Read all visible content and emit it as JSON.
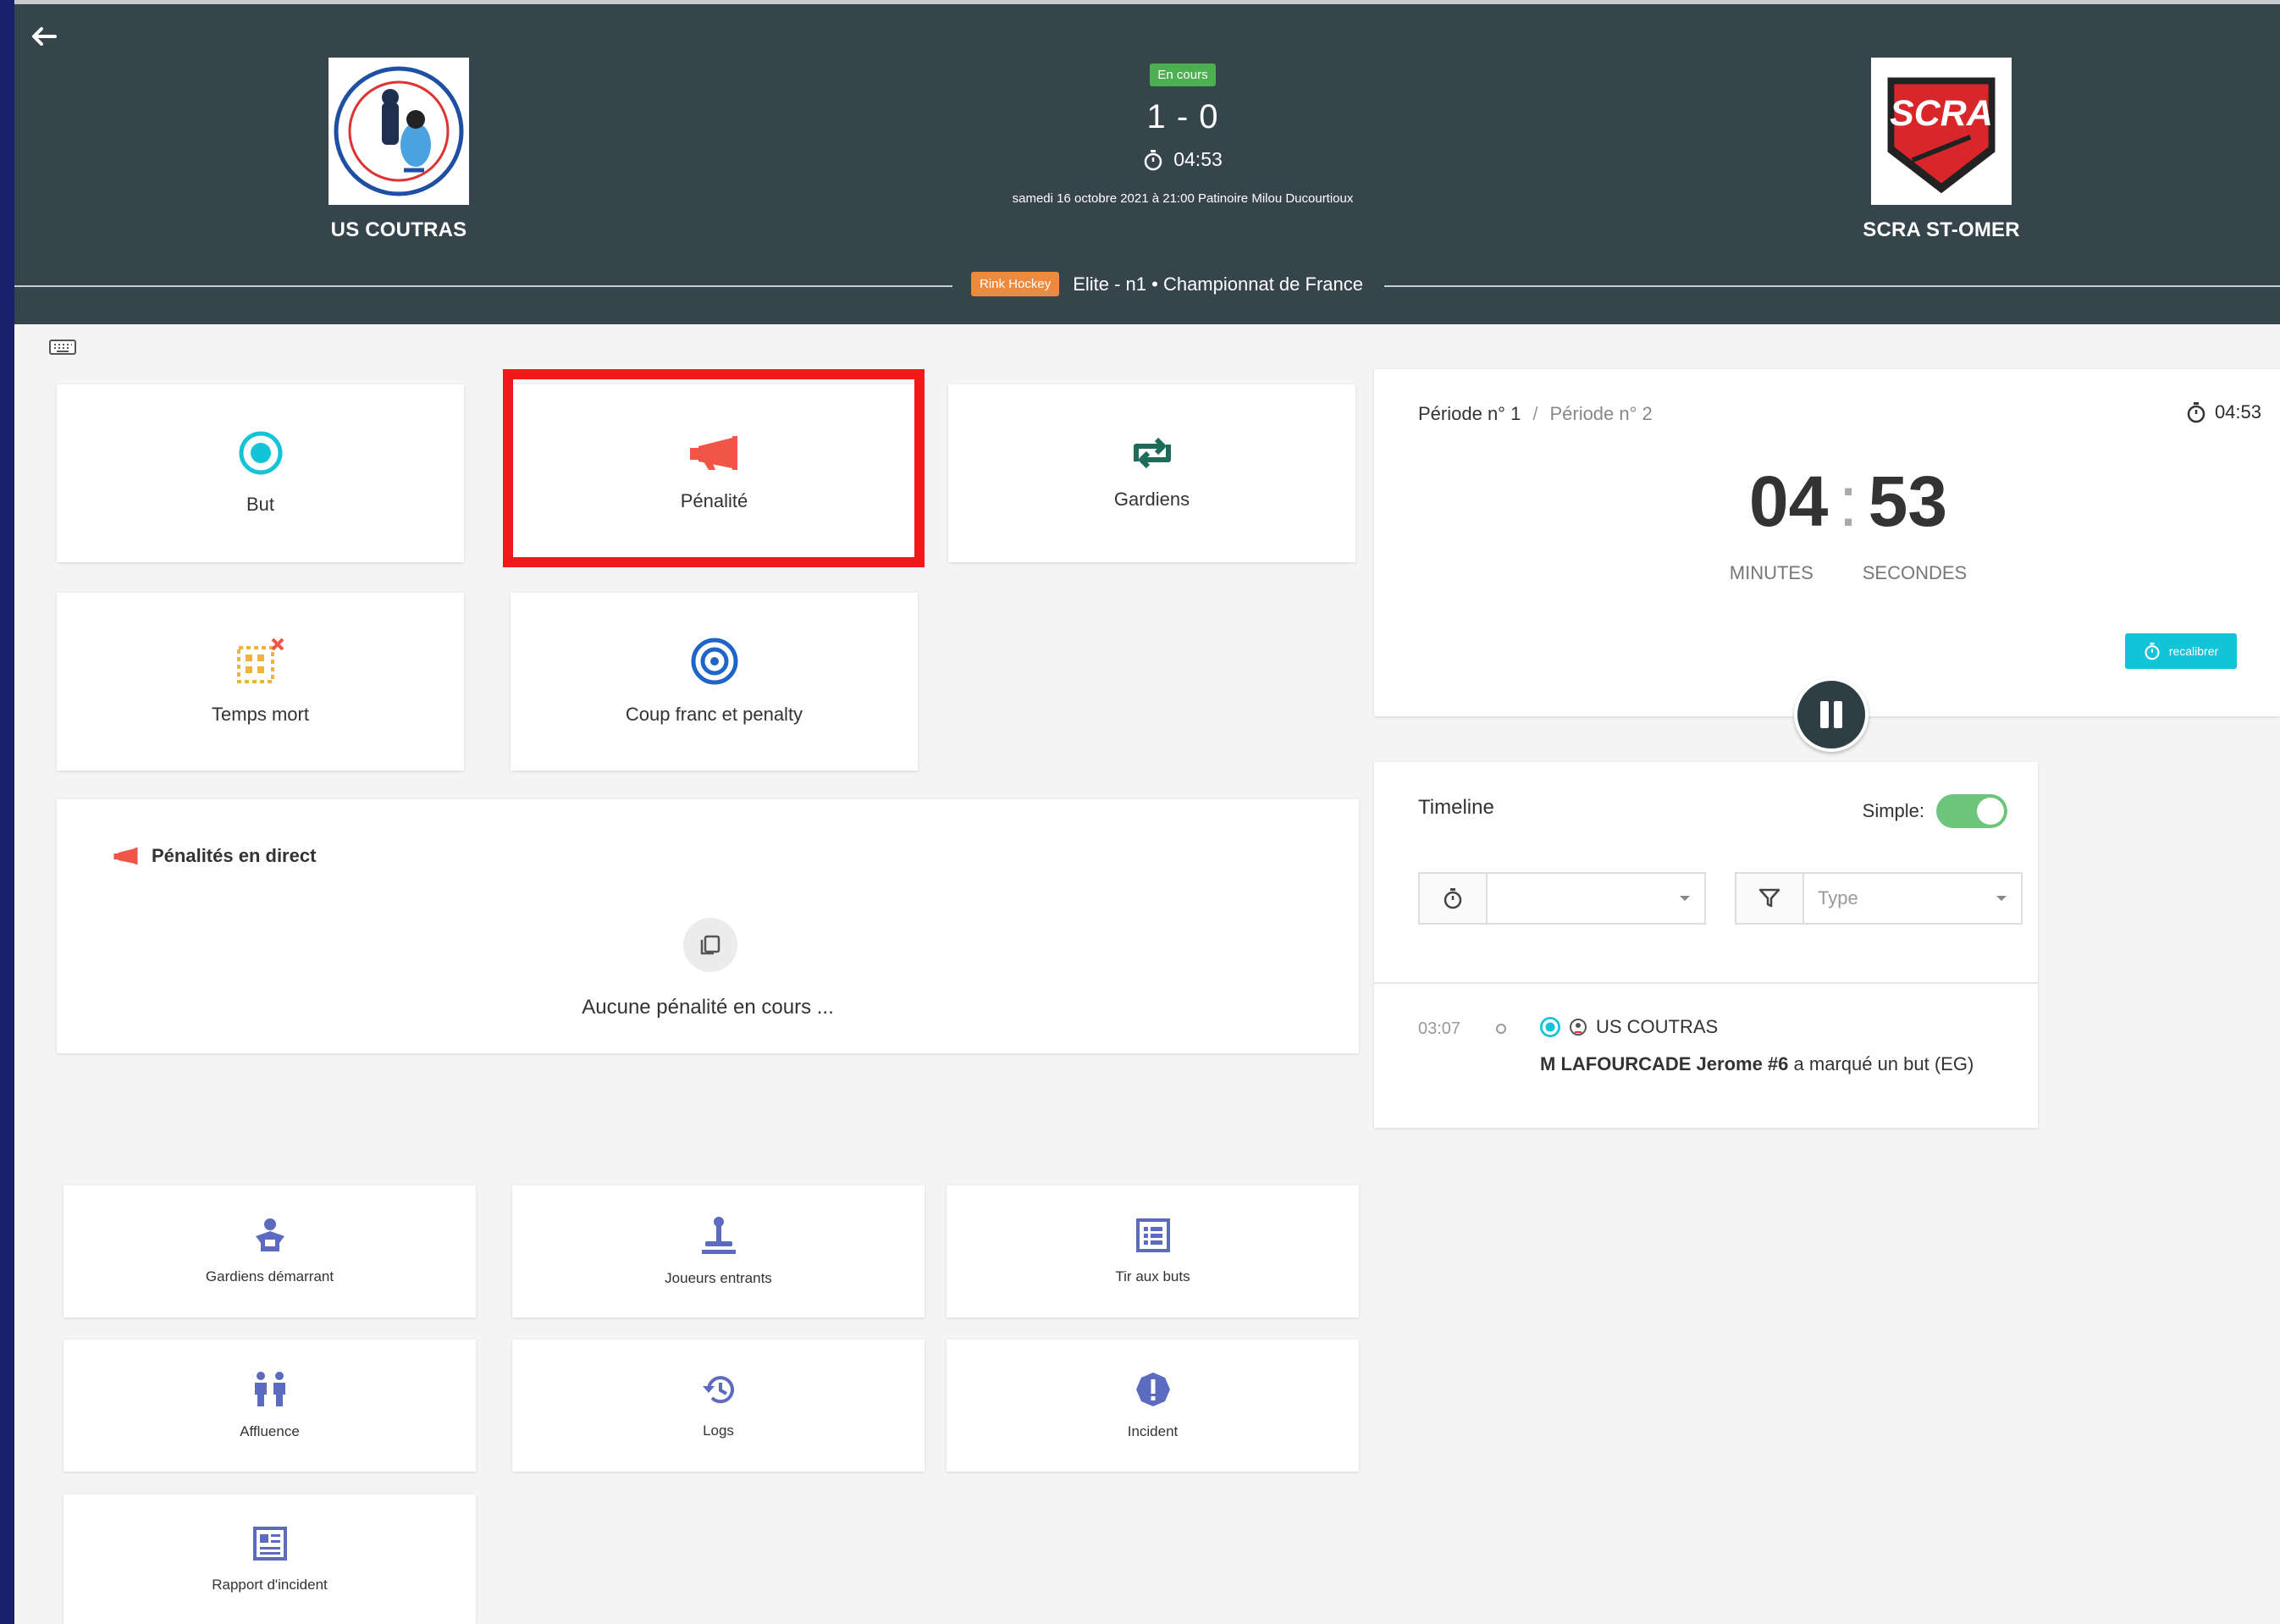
{
  "header": {
    "home_team": "US COUTRAS",
    "away_team": "SCRA ST-OMER",
    "status": "En cours",
    "score": "1 - 0",
    "timer": "04:53",
    "match_meta": "samedi 16 octobre 2021 à 21:00 Patinoire Milou Ducourtioux",
    "sport": "Rink Hockey",
    "competition": "Elite - n1 • Championnat de France",
    "away_logo_text": "SCRA"
  },
  "actions": {
    "but": "But",
    "penalite": "Pénalité",
    "gardiens": "Gardiens",
    "temps_mort": "Temps mort",
    "coup_franc": "Coup franc et penalty"
  },
  "penalties": {
    "title": "Pénalités en direct",
    "empty": "Aucune pénalité en cours ..."
  },
  "tools": {
    "gardiens_demarrant": "Gardiens démarrant",
    "joueurs_entrants": "Joueurs entrants",
    "tir_aux_buts": "Tir aux buts",
    "affluence": "Affluence",
    "logs": "Logs",
    "incident": "Incident",
    "rapport_incident": "Rapport d'incident"
  },
  "clock": {
    "period_1": "Période n° 1",
    "period_2": "Période n° 2",
    "separator": "/",
    "small_time": "04:53",
    "minutes": "04",
    "seconds": "53",
    "minutes_label": "MINUTES",
    "seconds_label": "SECONDES",
    "recalibrate": "recalibrer"
  },
  "timeline": {
    "title": "Timeline",
    "simple_label": "Simple:",
    "time_filter_value": "",
    "type_placeholder": "Type",
    "events": [
      {
        "time": "03:07",
        "team": "US COUTRAS",
        "player": "M LAFOURCADE Jerome #6",
        "action": "a marqué un but (EG)"
      }
    ]
  },
  "colors": {
    "header_bg": "#36444b",
    "accent_cyan": "#13c4d8",
    "live_green": "#4caf50",
    "sport_orange": "#ef8a3c",
    "penalty_red": "#f05545",
    "tool_indigo": "#5c6bc0",
    "highlight_red": "#f01818"
  }
}
